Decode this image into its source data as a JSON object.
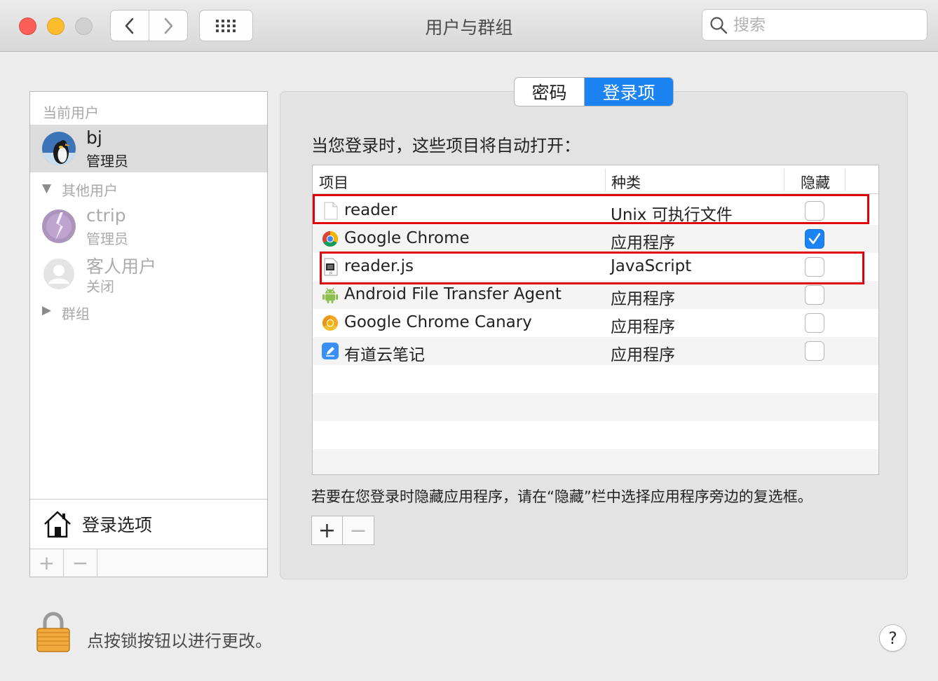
{
  "window": {
    "title": "用户与群组",
    "search_placeholder": "搜索"
  },
  "sidebar": {
    "current_users_header": "当前用户",
    "current_user": {
      "name": "bj",
      "role": "管理员"
    },
    "other_users_header": "其他用户",
    "other_users": [
      {
        "name": "ctrip",
        "role": "管理员"
      },
      {
        "name": "客人用户",
        "role": "关闭"
      }
    ],
    "groups_header": "群组",
    "login_options_label": "登录选项",
    "add_label": "+",
    "remove_label": "−"
  },
  "tabs": [
    {
      "label": "密码",
      "selected": false
    },
    {
      "label": "登录项",
      "selected": true
    }
  ],
  "main": {
    "intro": "当您登录时，这些项目将自动打开：",
    "columns": {
      "item": "项目",
      "kind": "种类",
      "hide": "隐藏"
    },
    "items": [
      {
        "name": "reader",
        "kind": "Unix 可执行文件",
        "hidden": false,
        "icon": "blank-document-icon"
      },
      {
        "name": "Google Chrome",
        "kind": "应用程序",
        "hidden": true,
        "icon": "google-chrome-icon"
      },
      {
        "name": "reader.js",
        "kind": "JavaScript",
        "hidden": false,
        "icon": "javascript-file-icon"
      },
      {
        "name": "Android File Transfer Agent",
        "kind": "应用程序",
        "hidden": false,
        "icon": "android-icon"
      },
      {
        "name": "Google Chrome Canary",
        "kind": "应用程序",
        "hidden": false,
        "icon": "chrome-canary-icon"
      },
      {
        "name": "有道云笔记",
        "kind": "应用程序",
        "hidden": false,
        "icon": "youdao-note-icon"
      }
    ],
    "hint": "若要在您登录时隐藏应用程序，请在“隐藏”栏中选择应用程序旁边的复选框。",
    "add_label": "+",
    "remove_label": "−"
  },
  "footer": {
    "lock_text": "点按锁按钮以进行更改。",
    "help_label": "?"
  },
  "colors": {
    "accent": "#1b83f2",
    "highlight_box": "#e0000b"
  }
}
